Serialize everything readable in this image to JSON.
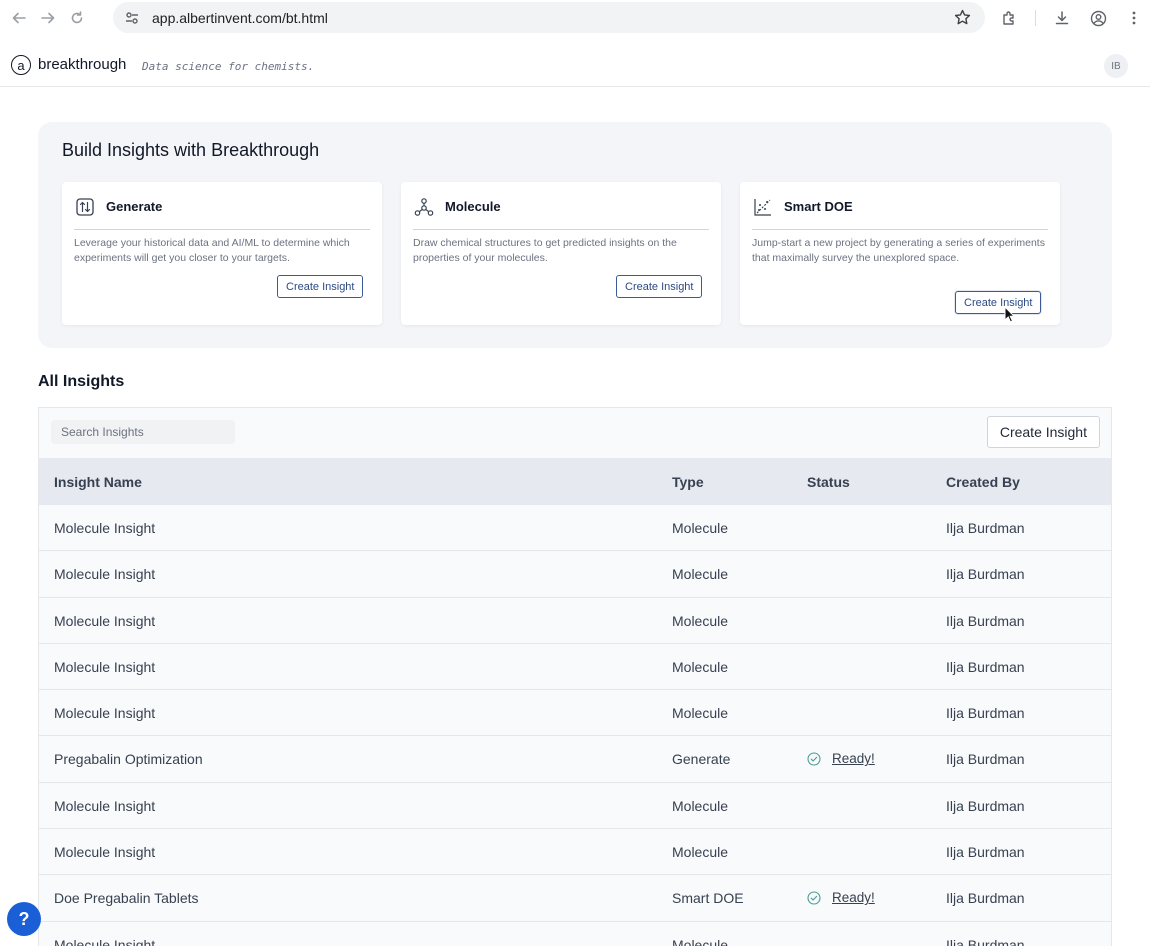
{
  "browser": {
    "url": "app.albertinvent.com/bt.html"
  },
  "app": {
    "logo_letter": "a",
    "brand": "breakthrough",
    "tagline": "Data science for chemists.",
    "avatar_initials": "IB"
  },
  "build": {
    "title": "Build Insights with Breakthrough",
    "cards": [
      {
        "title": "Generate",
        "icon": "sort-arrows-icon",
        "description": "Leverage your historical data and AI/ML to determine which experiments will get you closer to your targets.",
        "button": "Create Insight"
      },
      {
        "title": "Molecule",
        "icon": "molecule-icon",
        "description": "Draw chemical structures to get predicted insights on the properties of your molecules.",
        "button": "Create Insight"
      },
      {
        "title": "Smart DOE",
        "icon": "scatter-chart-icon",
        "description": "Jump-start a new project by generating a series of experiments that maximally survey the unexplored space.",
        "button": "Create Insight"
      }
    ]
  },
  "insights": {
    "title": "All Insights",
    "search_placeholder": "Search Insights",
    "create_button": "Create Insight",
    "columns": [
      "Insight Name",
      "Type",
      "Status",
      "Created By"
    ],
    "rows": [
      {
        "name": "Molecule Insight",
        "type": "Molecule",
        "status": "",
        "created_by": "Ilja Burdman"
      },
      {
        "name": "Molecule Insight",
        "type": "Molecule",
        "status": "",
        "created_by": "Ilja Burdman"
      },
      {
        "name": "Molecule Insight",
        "type": "Molecule",
        "status": "",
        "created_by": "Ilja Burdman"
      },
      {
        "name": "Molecule Insight",
        "type": "Molecule",
        "status": "",
        "created_by": "Ilja Burdman"
      },
      {
        "name": "Molecule Insight",
        "type": "Molecule",
        "status": "",
        "created_by": "Ilja Burdman"
      },
      {
        "name": "Pregabalin Optimization",
        "type": "Generate",
        "status": "Ready!",
        "created_by": "Ilja Burdman"
      },
      {
        "name": "Molecule Insight",
        "type": "Molecule",
        "status": "",
        "created_by": "Ilja Burdman"
      },
      {
        "name": "Molecule Insight",
        "type": "Molecule",
        "status": "",
        "created_by": "Ilja Burdman"
      },
      {
        "name": "Doe Pregabalin Tablets",
        "type": "Smart DOE",
        "status": "Ready!",
        "created_by": "Ilja Burdman"
      },
      {
        "name": "Molecule Insight",
        "type": "Molecule",
        "status": "",
        "created_by": "Ilja Burdman"
      }
    ]
  },
  "help": {
    "label": "?"
  }
}
